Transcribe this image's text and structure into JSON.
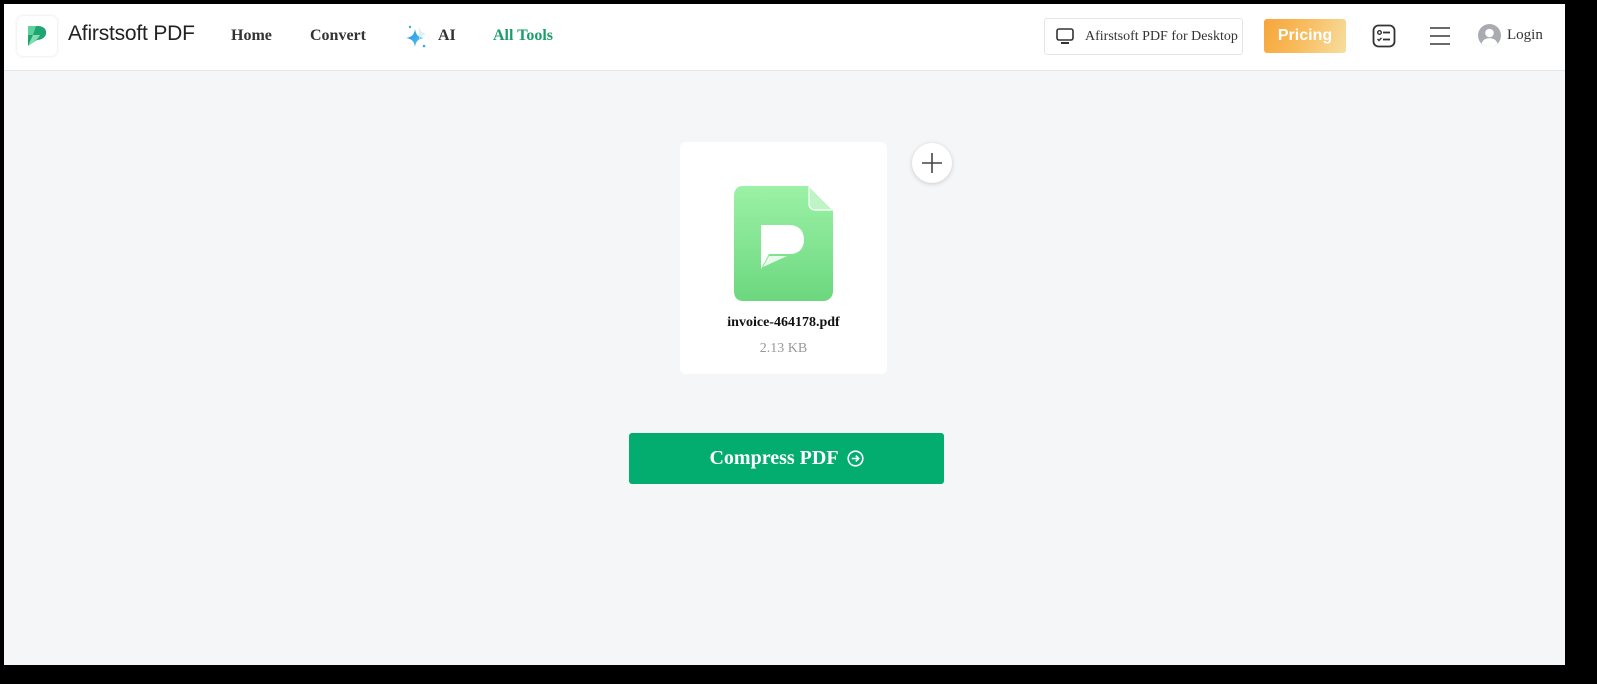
{
  "header": {
    "brand": "Afirstsoft PDF",
    "nav": {
      "home": "Home",
      "convert": "Convert",
      "ai": "AI",
      "all_tools": "All Tools"
    },
    "desktop_button": "Afirstsoft PDF for Desktop",
    "pricing_button": "Pricing",
    "login": "Login",
    "icons": {
      "logo": "afirstsoft-logo",
      "ai": "sparkle-icon",
      "desktop": "monitor-icon",
      "tasks": "task-list-icon",
      "menu": "hamburger-menu-icon",
      "avatar": "user-avatar-icon"
    }
  },
  "colors": {
    "accent_green": "#03ac6f",
    "nav_active": "#1a9e6a",
    "pricing_gradient_start": "#f6a63a",
    "pricing_gradient_end": "#f7dea0",
    "page_background": "#f5f6f8"
  },
  "file": {
    "name": "invoice-464178.pdf",
    "size": "2.13 KB",
    "icon": "pdf-file-icon"
  },
  "add_file_button": {
    "icon": "plus-icon"
  },
  "compress_button": {
    "label": "Compress PDF",
    "icon": "arrow-right-circle-icon"
  }
}
